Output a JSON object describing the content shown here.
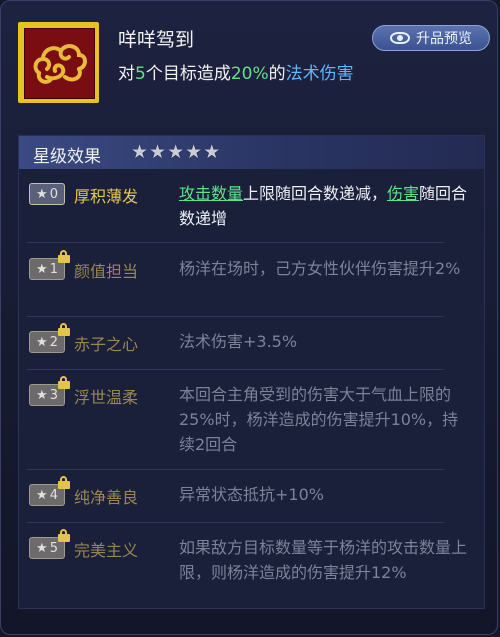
{
  "skill": {
    "title": "咩咩驾到",
    "desc_prefix": "对",
    "target_count": "5",
    "desc_mid": "个目标造成",
    "damage_pct": "20%",
    "desc_of": "的",
    "damage_type": "法术伤害",
    "icon": "auspicious-cloud-icon"
  },
  "preview_button": {
    "label": "升品预览",
    "icon": "eye-icon"
  },
  "star_section": {
    "title": "星级效果",
    "stars": 5
  },
  "effects": [
    {
      "level": "0",
      "name": "厚积薄发",
      "locked": false,
      "desc_parts": [
        {
          "t": "攻击数量",
          "s": "link"
        },
        {
          "t": "上限随回合数递减，",
          "s": "n"
        },
        {
          "t": "伤害",
          "s": "link"
        },
        {
          "t": "随回合数递增",
          "s": "n"
        }
      ]
    },
    {
      "level": "1",
      "name": "颜值担当",
      "locked": true,
      "desc": "杨洋在场时，己方女性伙伴伤害提升2%"
    },
    {
      "level": "2",
      "name": "赤子之心",
      "locked": true,
      "desc": "法术伤害+3.5%"
    },
    {
      "level": "3",
      "name": "浮世温柔",
      "locked": true,
      "desc": "本回合主角受到的伤害大于气血上限的25%时，杨洋造成的伤害提升10%，持续2回合"
    },
    {
      "level": "4",
      "name": "纯净善良",
      "locked": true,
      "desc": "异常状态抵抗+10%"
    },
    {
      "level": "5",
      "name": "完美主义",
      "locked": true,
      "desc": "如果敌方目标数量等于杨洋的攻击数量上限，则杨洋造成的伤害提升12%"
    }
  ],
  "colors": {
    "accent_green": "#5fe38a",
    "accent_blue": "#5fb6ff",
    "gold": "#e7c74d"
  }
}
